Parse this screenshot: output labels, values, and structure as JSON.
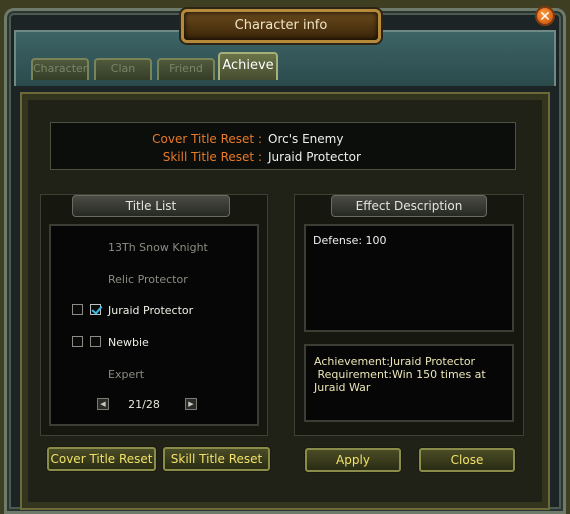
{
  "window": {
    "title": "Character info",
    "close_glyph": "✕"
  },
  "tabs": [
    {
      "label": "Character",
      "active": false
    },
    {
      "label": "Clan",
      "active": false
    },
    {
      "label": "Friend",
      "active": false
    },
    {
      "label": "Achieve",
      "active": true
    }
  ],
  "titles_summary": {
    "cover_label": "Cover Title Reset :",
    "cover_value": "Orc's Enemy",
    "skill_label": "Skill Title Reset :",
    "skill_value": "Juraid Protector"
  },
  "title_list": {
    "header": "Title List",
    "items": [
      {
        "label": "13Th Snow Knight",
        "selected": false,
        "show_checkboxes": false
      },
      {
        "label": "Relic Protector",
        "selected": false,
        "show_checkboxes": false
      },
      {
        "label": "Juraid Protector",
        "selected": true,
        "show_checkboxes": true,
        "cover_checked": false,
        "skill_checked": true
      },
      {
        "label": "Newbie",
        "selected": true,
        "show_checkboxes": true,
        "cover_checked": false,
        "skill_checked": false
      },
      {
        "label": "Expert",
        "selected": false,
        "show_checkboxes": false
      }
    ],
    "page": "21/28",
    "prev_glyph": "◀",
    "next_glyph": "▶"
  },
  "effect": {
    "header": "Effect Description",
    "text": "Defense: 100",
    "achievement_line1": "Achievement:Juraid Protector",
    "achievement_line2": " Requirement:Win 150 times at",
    "achievement_line3": "Juraid War"
  },
  "buttons": {
    "cover_reset": "Cover Title Reset",
    "skill_reset": "Skill Title Reset",
    "apply": "Apply",
    "close": "Close"
  },
  "colors": {
    "accent_orange": "#e87a28",
    "button_text": "#f2e26a",
    "check_mark": "#3ac0e8"
  }
}
